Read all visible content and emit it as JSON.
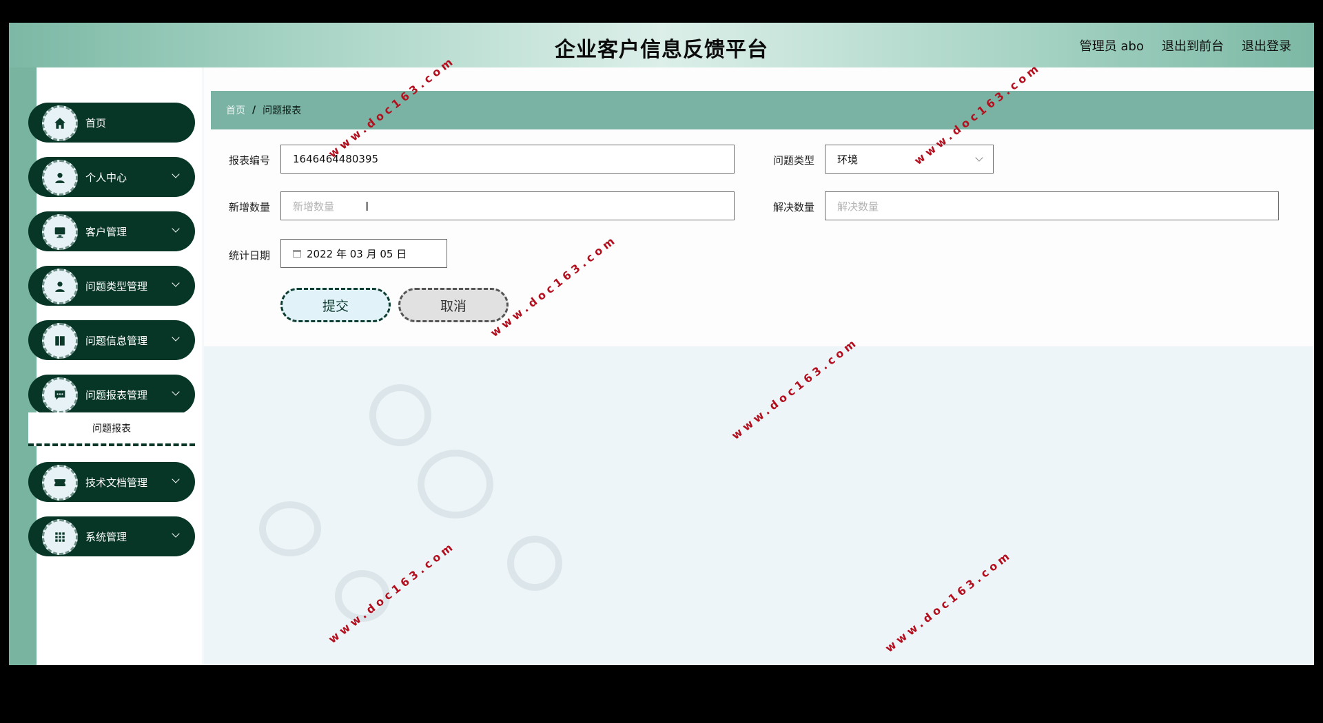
{
  "header": {
    "title": "企业客户信息反馈平台",
    "user_label": "管理员 abo",
    "front_link": "退出到前台",
    "logout_link": "退出登录"
  },
  "sidebar": {
    "items": [
      {
        "label": "首页",
        "icon": "home-icon"
      },
      {
        "label": "个人中心",
        "icon": "user-icon"
      },
      {
        "label": "客户管理",
        "icon": "monitor-icon"
      },
      {
        "label": "问题类型管理",
        "icon": "user-icon"
      },
      {
        "label": "问题信息管理",
        "icon": "book-icon"
      },
      {
        "label": "问题报表管理",
        "icon": "chat-icon"
      },
      {
        "label": "技术文档管理",
        "icon": "ticket-icon"
      },
      {
        "label": "系统管理",
        "icon": "grid-icon"
      }
    ],
    "submenu_label": "问题报表"
  },
  "breadcrumb": {
    "home": "首页",
    "separator": "/",
    "current": "问题报表"
  },
  "form": {
    "report_no_label": "报表编号",
    "report_no_value": "1646464480395",
    "issue_type_label": "问题类型",
    "issue_type_value": "环境",
    "new_count_label": "新增数量",
    "new_count_placeholder": "新增数量",
    "resolved_count_label": "解决数量",
    "resolved_count_placeholder": "解决数量",
    "stat_date_label": "统计日期",
    "stat_date_value": "2022 年 03 月 05 日",
    "submit_label": "提交",
    "cancel_label": "取消"
  },
  "watermark": "www.doc163.com",
  "colors": {
    "sidebar_dark": "#083626",
    "accent_green": "#7ab3a3",
    "watermark_red": "#b20f1f"
  }
}
